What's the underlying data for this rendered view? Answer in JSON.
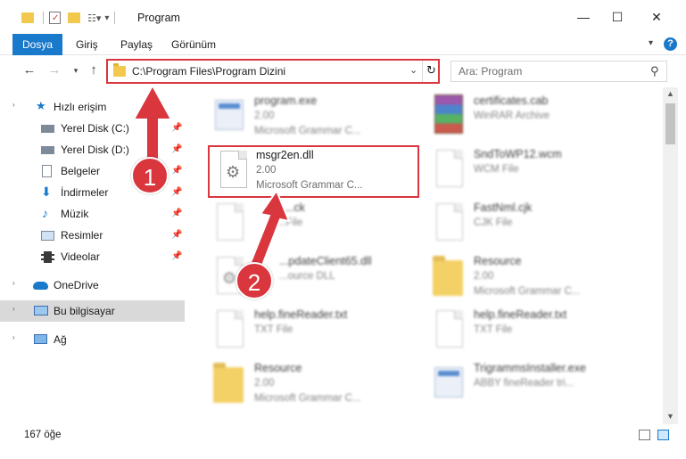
{
  "window": {
    "title": "Program",
    "controls": {
      "minimize": "—",
      "maximize": "☐",
      "close": "✕"
    }
  },
  "ribbon": {
    "tabs": [
      "Dosya",
      "Giriş",
      "Paylaş",
      "Görünüm"
    ],
    "help": "?"
  },
  "address": {
    "path": "C:\\Program Files\\Program Dizini"
  },
  "search": {
    "placeholder": "Ara: Program"
  },
  "sidebar": {
    "items": [
      {
        "label": "Hızlı erişim",
        "icon": "star-icon"
      },
      {
        "label": "Yerel Disk (C:)",
        "icon": "drive-icon",
        "pinned": true
      },
      {
        "label": "Yerel Disk (D:)",
        "icon": "drive-icon",
        "pinned": true
      },
      {
        "label": "Belgeler",
        "icon": "document-icon",
        "pinned": true
      },
      {
        "label": "İndirmeler",
        "icon": "download-icon",
        "pinned": true
      },
      {
        "label": "Müzik",
        "icon": "music-icon",
        "pinned": true
      },
      {
        "label": "Resimler",
        "icon": "pictures-icon",
        "pinned": true
      },
      {
        "label": "Videolar",
        "icon": "video-icon",
        "pinned": true
      },
      {
        "label": "OneDrive",
        "icon": "cloud-icon"
      },
      {
        "label": "Bu bilgisayar",
        "icon": "computer-icon",
        "selected": true
      },
      {
        "label": "Ağ",
        "icon": "network-icon"
      }
    ]
  },
  "files": {
    "left": [
      {
        "name": "program.exe",
        "sub1": "2.00",
        "sub2": "Microsoft Grammar C...",
        "icon": "exe-icon"
      },
      {
        "name": "msgr2en.dll",
        "sub1": "2.00",
        "sub2": "Microsoft Grammar C...",
        "icon": "dll-gear-icon"
      },
      {
        "name": "...ck",
        "sub1": "...File",
        "sub2": "",
        "icon": "blank-file-icon"
      },
      {
        "name": "...pdateClient65.dll",
        "sub1": "...ource DLL",
        "sub2": "",
        "icon": "dll-gear-icon"
      },
      {
        "name": "help.fineReader.txt",
        "sub1": "TXT File",
        "sub2": "",
        "icon": "blank-file-icon"
      },
      {
        "name": "Resource",
        "sub1": "2.00",
        "sub2": "Microsoft Grammar C...",
        "icon": "folder-icon"
      }
    ],
    "right": [
      {
        "name": "certificates.cab",
        "sub1": "WinRAR Archive",
        "sub2": "",
        "icon": "rar-icon"
      },
      {
        "name": "SndToWP12.wcm",
        "sub1": "WCM File",
        "sub2": "",
        "icon": "blank-file-icon"
      },
      {
        "name": "FastNml.cjk",
        "sub1": "CJK File",
        "sub2": "",
        "icon": "blank-file-icon"
      },
      {
        "name": "Resource",
        "sub1": "2.00",
        "sub2": "Microsoft Grammar C...",
        "icon": "folder-icon"
      },
      {
        "name": "help.fineReader.txt",
        "sub1": "TXT File",
        "sub2": "",
        "icon": "blank-file-icon"
      },
      {
        "name": "TrigrammsInstaller.exe",
        "sub1": "ABBY fineReader tri...",
        "sub2": "",
        "icon": "exe-icon"
      }
    ]
  },
  "status": {
    "count": "167 öğe"
  },
  "callouts": {
    "one": "1",
    "two": "2"
  },
  "colors": {
    "accent": "#1979ca",
    "highlight": "#d9363e",
    "selected": "#cde8ff"
  }
}
